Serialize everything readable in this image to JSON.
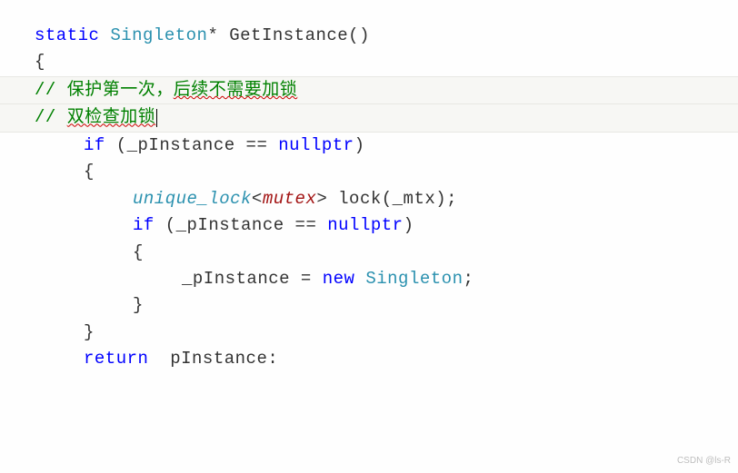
{
  "code": {
    "l1_kw": "static",
    "l1_type": " Singleton",
    "l1_rest": "* GetInstance()",
    "l2": "{",
    "l3_prefix": "// ",
    "l3_c1": "保护第一次，",
    "l3_c2": "后续不需要加锁",
    "l4_prefix": "// ",
    "l4_c1": "双检查加锁",
    "l5_kw": "if",
    "l5_cond": " (_pInstance == ",
    "l5_null": "nullptr",
    "l5_close": ")",
    "l6": "{",
    "l7_ul": "unique_lock",
    "l7_lt": "<",
    "l7_mutex": "mutex",
    "l7_gt": "> lock(_mtx);",
    "l8_kw": "if",
    "l8_cond": " (_pInstance == ",
    "l8_null": "nullptr",
    "l8_close": ")",
    "l9": "{",
    "l10_lhs": "_pInstance = ",
    "l10_new": "new",
    "l10_type": " Singleton",
    "l10_semi": ";",
    "l11": "}",
    "l12": "}",
    "blank": "",
    "l13_kw": "return",
    "l13_rest": "  pInstance:"
  },
  "watermark": "CSDN @ls-R"
}
